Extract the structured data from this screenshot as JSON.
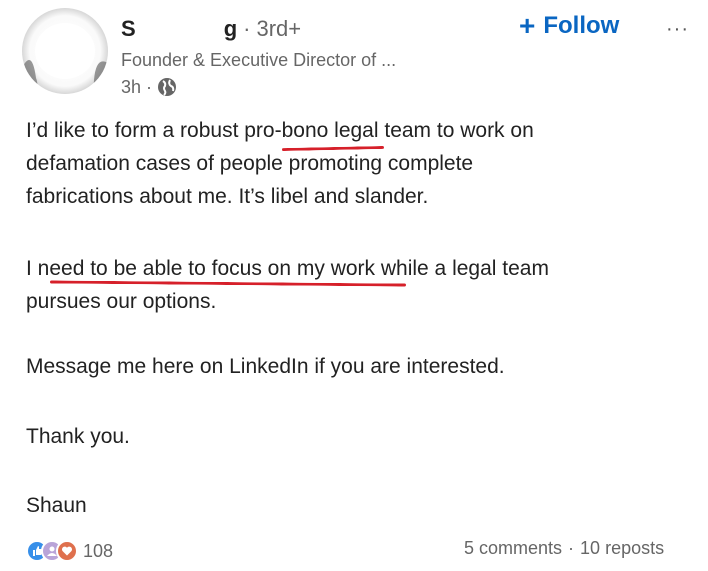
{
  "author": {
    "name_first": "S",
    "name_last": "g",
    "degree": "3rd+",
    "headline": "Founder & Executive Director of ...",
    "time_ago": "3h"
  },
  "actions": {
    "follow_plus": "+",
    "follow_label": "Follow",
    "more_label": "···"
  },
  "post": {
    "paragraphs": [
      [
        "I’d like to form a robust pro-bono legal team to work on",
        "defamation cases of people promoting complete",
        "fabrications about me. It’s libel and slander."
      ],
      [
        "I need to be able to focus on my work while a legal team",
        "pursues our options."
      ],
      [
        "Message me here on LinkedIn if you are interested."
      ],
      [
        "Thank you."
      ],
      [
        "Shaun"
      ]
    ]
  },
  "social": {
    "reaction_count": "108",
    "comments": "5 comments",
    "reposts": "10 reposts"
  },
  "colors": {
    "accent": "#0a66c2",
    "annotation": "#d6202a",
    "secondary_text": "#666666"
  },
  "icons": [
    "avatar",
    "globe-icon",
    "like-reaction-icon",
    "support-reaction-icon",
    "love-reaction-icon"
  ]
}
